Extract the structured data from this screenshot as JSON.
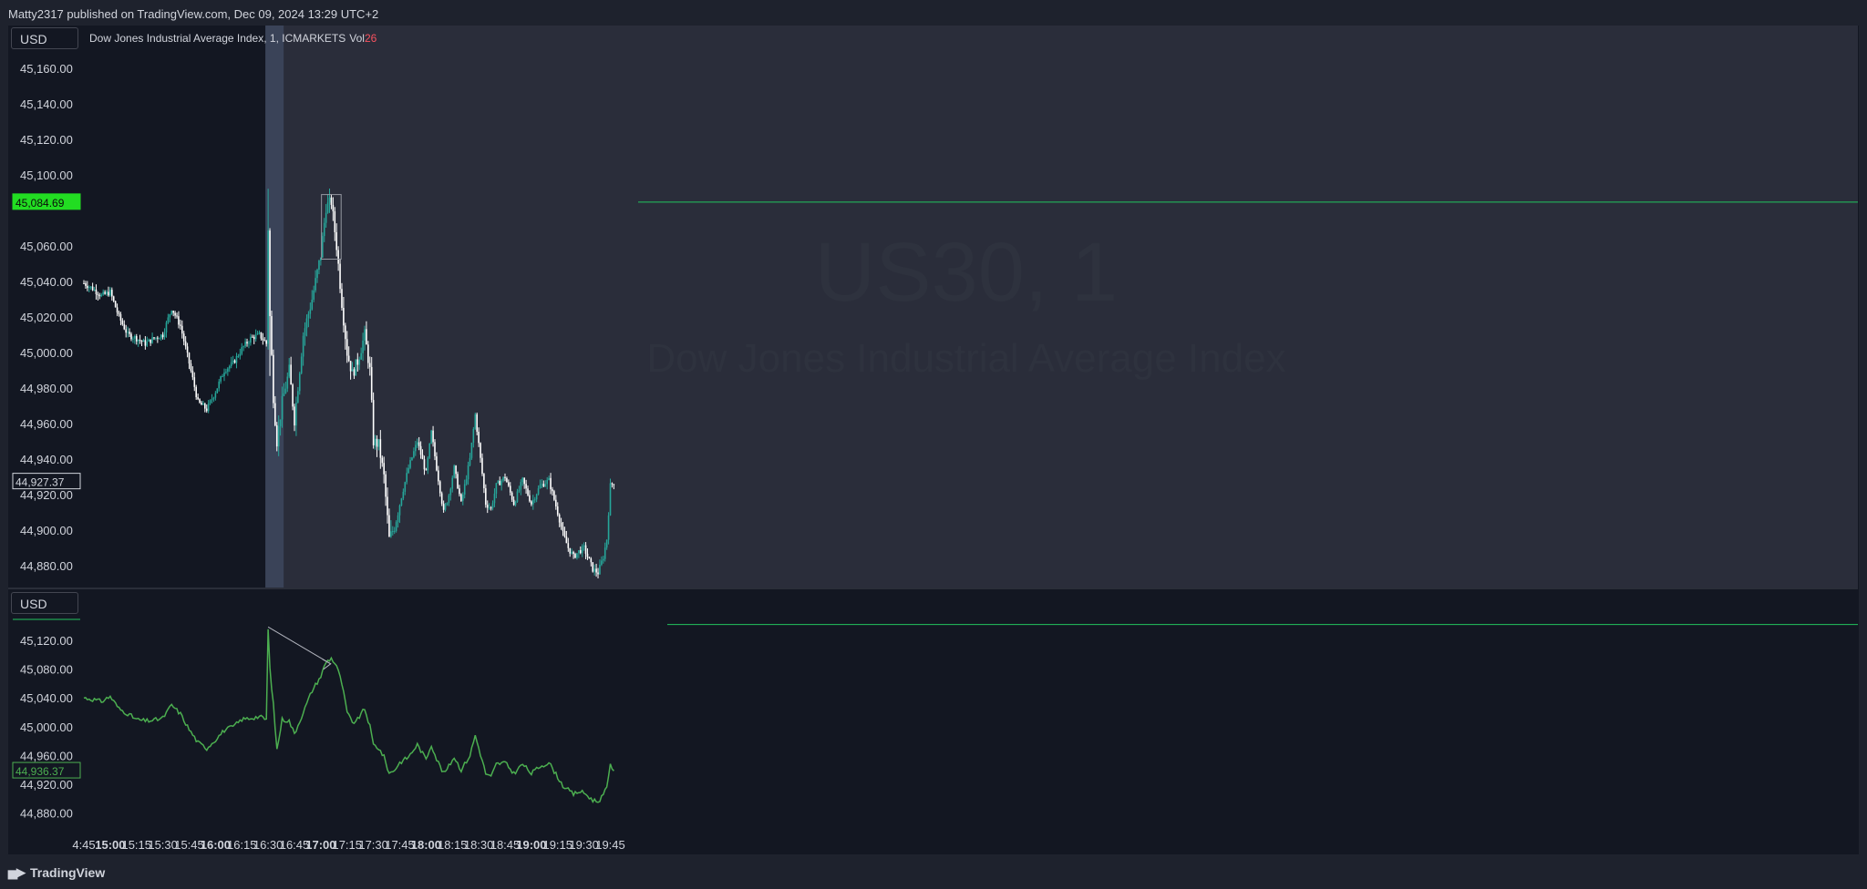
{
  "header": {
    "published_line": "Matty2317 published on TradingView.com, Dec 09, 2024 13:29 UTC+2"
  },
  "top_pane": {
    "currency_button": "USD",
    "legend_title": "Dow Jones Industrial Average Index, 1, ICMARKETS",
    "volume_label": "Vol",
    "volume_value": "26",
    "watermark_symbol": "US30, 1",
    "watermark_name": "Dow Jones Industrial Average Index",
    "price_ticks": [
      "45,160.00",
      "45,140.00",
      "45,120.00",
      "45,100.00",
      "45,060.00",
      "45,040.00",
      "45,020.00",
      "45,000.00",
      "44,980.00",
      "44,960.00",
      "44,940.00",
      "44,920.00",
      "44,900.00",
      "44,880.00"
    ],
    "level_label": "45,084.69",
    "last_price_label": "44,927.37"
  },
  "bottom_pane": {
    "currency_button": "USD",
    "price_ticks": [
      "45,120.00",
      "45,080.00",
      "45,040.00",
      "45,000.00",
      "44,960.00",
      "44,920.00",
      "44,880.00"
    ],
    "last_price_label": "44,936.37"
  },
  "time_axis": {
    "labels": [
      "4:45",
      "15:00",
      "15:15",
      "15:30",
      "15:45",
      "16:00",
      "16:15",
      "16:30",
      "16:45",
      "17:00",
      "17:15",
      "17:30",
      "17:45",
      "18:00",
      "18:15",
      "18:30",
      "18:45",
      "19:00",
      "19:15",
      "19:30",
      "19:45"
    ],
    "bold": [
      "15:00",
      "16:00",
      "17:00",
      "18:00",
      "19:00"
    ]
  },
  "footer": {
    "brand": "TradingView"
  },
  "colors": {
    "background": "#131722",
    "session_shade": "#2a2d3a",
    "up_candle": "#26a69a",
    "down_candle": "#ffffff",
    "level_line": "#22c55e",
    "line_series": "#4caf50"
  },
  "chart_data": [
    {
      "type": "candlestick",
      "title": "Dow Jones Industrial Average Index, 1, ICMARKETS",
      "x_unit": "time (UTC+2), 1-minute bars",
      "x_range": [
        "14:45",
        "19:47"
      ],
      "ylim": [
        44870,
        45170
      ],
      "horizontal_line": 45084.69,
      "last_price": 44927.37,
      "anchors": [
        [
          "14:45",
          45039
        ],
        [
          "14:50",
          45036
        ],
        [
          "14:55",
          45032
        ],
        [
          "15:00",
          45034
        ],
        [
          "15:05",
          45020
        ],
        [
          "15:10",
          45010
        ],
        [
          "15:15",
          45008
        ],
        [
          "15:20",
          45005
        ],
        [
          "15:25",
          45008
        ],
        [
          "15:30",
          45010
        ],
        [
          "15:35",
          45025
        ],
        [
          "15:40",
          45015
        ],
        [
          "15:45",
          44994
        ],
        [
          "15:50",
          44972
        ],
        [
          "15:55",
          44968
        ],
        [
          "16:00",
          44978
        ],
        [
          "16:05",
          44990
        ],
        [
          "16:10",
          44994
        ],
        [
          "16:15",
          45002
        ],
        [
          "16:20",
          45008
        ],
        [
          "16:25",
          45010
        ],
        [
          "16:29",
          45005
        ],
        [
          "16:30",
          45070
        ],
        [
          "16:31",
          45020
        ],
        [
          "16:33",
          44975
        ],
        [
          "16:35",
          44950
        ],
        [
          "16:38",
          44972
        ],
        [
          "16:42",
          44990
        ],
        [
          "16:45",
          44962
        ],
        [
          "16:50",
          45010
        ],
        [
          "16:55",
          45030
        ],
        [
          "17:00",
          45055
        ],
        [
          "17:03",
          45082
        ],
        [
          "17:06",
          45085
        ],
        [
          "17:09",
          45060
        ],
        [
          "17:12",
          45028
        ],
        [
          "17:15",
          45000
        ],
        [
          "17:18",
          44988
        ],
        [
          "17:21",
          44995
        ],
        [
          "17:25",
          45010
        ],
        [
          "17:28",
          44990
        ],
        [
          "17:30",
          44950
        ],
        [
          "17:33",
          44948
        ],
        [
          "17:36",
          44930
        ],
        [
          "17:39",
          44895
        ],
        [
          "17:42",
          44902
        ],
        [
          "17:45",
          44915
        ],
        [
          "17:50",
          44935
        ],
        [
          "17:55",
          44950
        ],
        [
          "18:00",
          44932
        ],
        [
          "18:03",
          44955
        ],
        [
          "18:06",
          44935
        ],
        [
          "18:10",
          44910
        ],
        [
          "18:13",
          44920
        ],
        [
          "18:16",
          44935
        ],
        [
          "18:20",
          44915
        ],
        [
          "18:25",
          44940
        ],
        [
          "18:28",
          44965
        ],
        [
          "18:31",
          44940
        ],
        [
          "18:34",
          44915
        ],
        [
          "18:37",
          44912
        ],
        [
          "18:40",
          44925
        ],
        [
          "18:45",
          44930
        ],
        [
          "18:50",
          44915
        ],
        [
          "18:55",
          44928
        ],
        [
          "19:00",
          44915
        ],
        [
          "19:05",
          44925
        ],
        [
          "19:10",
          44928
        ],
        [
          "19:15",
          44910
        ],
        [
          "19:18",
          44898
        ],
        [
          "19:21",
          44890
        ],
        [
          "19:24",
          44885
        ],
        [
          "19:27",
          44888
        ],
        [
          "19:30",
          44890
        ],
        [
          "19:35",
          44878
        ],
        [
          "19:38",
          44876
        ],
        [
          "19:41",
          44885
        ],
        [
          "19:43",
          44895
        ],
        [
          "19:45",
          44925
        ],
        [
          "19:47",
          44927
        ]
      ],
      "highlight_box": {
        "from": "17:03",
        "to": "17:09",
        "low": 45070,
        "high": 45092
      }
    },
    {
      "type": "line",
      "x_unit": "time (UTC+2), 1-minute",
      "x_range": [
        "14:45",
        "19:47"
      ],
      "ylim": [
        44860,
        45145
      ],
      "horizontal_line": 45137,
      "last_price": 44936.37,
      "anchors": [
        [
          "14:45",
          45040
        ],
        [
          "14:50",
          45038
        ],
        [
          "14:55",
          45035
        ],
        [
          "15:00",
          45042
        ],
        [
          "15:05",
          45025
        ],
        [
          "15:10",
          45018
        ],
        [
          "15:15",
          45010
        ],
        [
          "15:20",
          45008
        ],
        [
          "15:25",
          45009
        ],
        [
          "15:30",
          45012
        ],
        [
          "15:35",
          45030
        ],
        [
          "15:40",
          45018
        ],
        [
          "15:45",
          44996
        ],
        [
          "15:50",
          44978
        ],
        [
          "15:55",
          44970
        ],
        [
          "16:00",
          44982
        ],
        [
          "16:05",
          44995
        ],
        [
          "16:10",
          45000
        ],
        [
          "16:15",
          45010
        ],
        [
          "16:20",
          45012
        ],
        [
          "16:25",
          45014
        ],
        [
          "16:29",
          45010
        ],
        [
          "16:30",
          45135
        ],
        [
          "16:31",
          45080
        ],
        [
          "16:33",
          45030
        ],
        [
          "16:35",
          44968
        ],
        [
          "16:38",
          45010
        ],
        [
          "16:42",
          45008
        ],
        [
          "16:45",
          44990
        ],
        [
          "16:50",
          45020
        ],
        [
          "16:55",
          45050
        ],
        [
          "17:00",
          45070
        ],
        [
          "17:03",
          45090
        ],
        [
          "17:06",
          45095
        ],
        [
          "17:09",
          45085
        ],
        [
          "17:12",
          45060
        ],
        [
          "17:15",
          45020
        ],
        [
          "17:18",
          45005
        ],
        [
          "17:21",
          45010
        ],
        [
          "17:25",
          45025
        ],
        [
          "17:28",
          45000
        ],
        [
          "17:30",
          44975
        ],
        [
          "17:33",
          44970
        ],
        [
          "17:36",
          44958
        ],
        [
          "17:39",
          44935
        ],
        [
          "17:42",
          44940
        ],
        [
          "17:45",
          44950
        ],
        [
          "17:50",
          44958
        ],
        [
          "17:55",
          44975
        ],
        [
          "18:00",
          44955
        ],
        [
          "18:03",
          44975
        ],
        [
          "18:06",
          44955
        ],
        [
          "18:10",
          44935
        ],
        [
          "18:13",
          44945
        ],
        [
          "18:16",
          44958
        ],
        [
          "18:20",
          44940
        ],
        [
          "18:25",
          44960
        ],
        [
          "18:28",
          44988
        ],
        [
          "18:31",
          44962
        ],
        [
          "18:34",
          44935
        ],
        [
          "18:37",
          44930
        ],
        [
          "18:40",
          44948
        ],
        [
          "18:45",
          44950
        ],
        [
          "18:50",
          44935
        ],
        [
          "18:55",
          44948
        ],
        [
          "19:00",
          44935
        ],
        [
          "19:05",
          44945
        ],
        [
          "19:10",
          44950
        ],
        [
          "19:15",
          44930
        ],
        [
          "19:18",
          44918
        ],
        [
          "19:21",
          44912
        ],
        [
          "19:24",
          44906
        ],
        [
          "19:27",
          44910
        ],
        [
          "19:30",
          44908
        ],
        [
          "19:35",
          44898
        ],
        [
          "19:38",
          44896
        ],
        [
          "19:41",
          44905
        ],
        [
          "19:43",
          44915
        ],
        [
          "19:45",
          44950
        ],
        [
          "19:47",
          44936
        ]
      ],
      "arrow": {
        "from": [
          "16:30",
          45136
        ],
        "to": [
          "17:15",
          45100
        ]
      }
    }
  ]
}
